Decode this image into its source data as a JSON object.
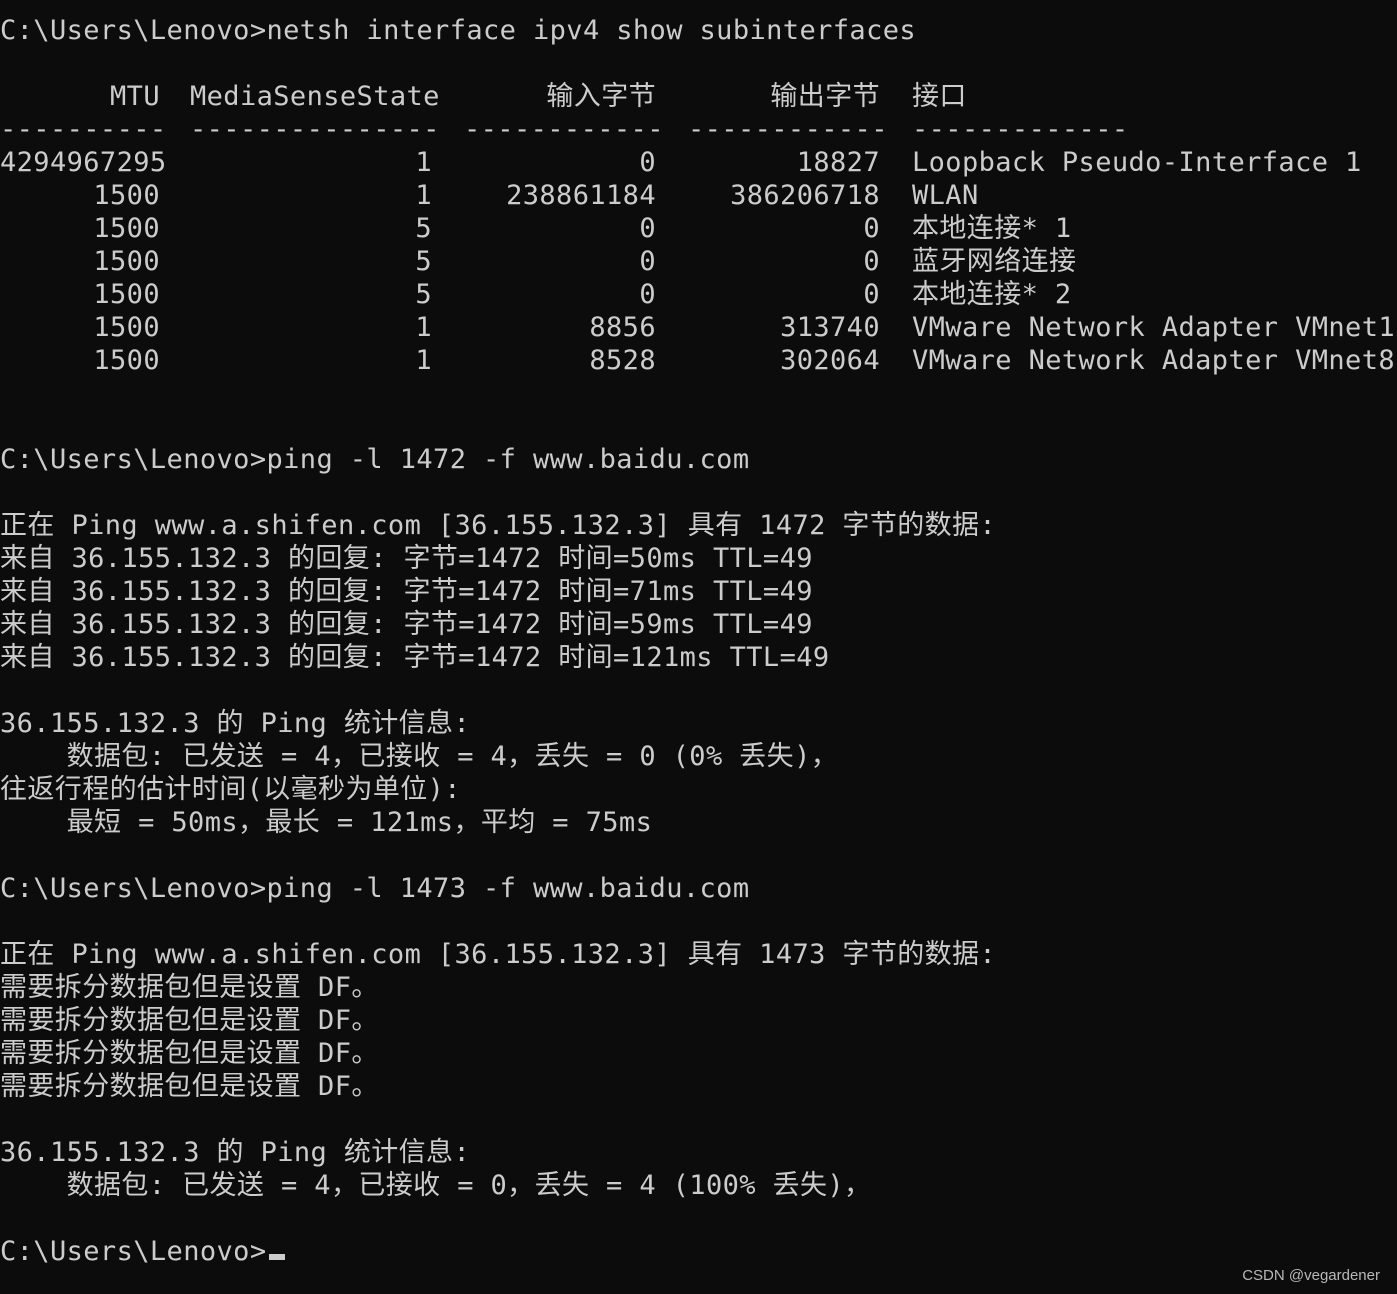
{
  "commands": {
    "c1": "C:\\Users\\Lenovo>netsh interface ipv4 show subinterfaces",
    "c2": "C:\\Users\\Lenovo>ping -l 1472 -f www.baidu.com",
    "c3": "C:\\Users\\Lenovo>ping -l 1473 -f www.baidu.com",
    "prompt": "C:\\Users\\Lenovo>"
  },
  "table": {
    "headers": [
      "MTU",
      "MediaSenseState",
      "输入字节",
      "输出字节",
      "接口"
    ],
    "dashes": [
      "----------",
      "---------------",
      "------------",
      "------------",
      "-------------"
    ],
    "rows": [
      [
        "4294967295",
        "1",
        "0",
        "18827",
        "Loopback Pseudo-Interface 1"
      ],
      [
        "1500",
        "1",
        "238861184",
        "386206718",
        "WLAN"
      ],
      [
        "1500",
        "5",
        "0",
        "0",
        "本地连接* 1"
      ],
      [
        "1500",
        "5",
        "0",
        "0",
        "蓝牙网络连接"
      ],
      [
        "1500",
        "5",
        "0",
        "0",
        "本地连接* 2"
      ],
      [
        "1500",
        "1",
        "8856",
        "313740",
        "VMware Network Adapter VMnet1"
      ],
      [
        "1500",
        "1",
        "8528",
        "302064",
        "VMware Network Adapter VMnet8"
      ]
    ]
  },
  "ping1": {
    "header": "正在 Ping www.a.shifen.com [36.155.132.3] 具有 1472 字节的数据:",
    "replies": [
      "来自 36.155.132.3 的回复: 字节=1472 时间=50ms TTL=49",
      "来自 36.155.132.3 的回复: 字节=1472 时间=71ms TTL=49",
      "来自 36.155.132.3 的回复: 字节=1472 时间=59ms TTL=49",
      "来自 36.155.132.3 的回复: 字节=1472 时间=121ms TTL=49"
    ],
    "stats_title": "36.155.132.3 的 Ping 统计信息:",
    "stats_packets": "    数据包: 已发送 = 4，已接收 = 4，丢失 = 0 (0% 丢失)，",
    "rtt_title": "往返行程的估计时间(以毫秒为单位):",
    "rtt_values": "    最短 = 50ms，最长 = 121ms，平均 = 75ms"
  },
  "ping2": {
    "header": "正在 Ping www.a.shifen.com [36.155.132.3] 具有 1473 字节的数据:",
    "replies": [
      "需要拆分数据包但是设置 DF。",
      "需要拆分数据包但是设置 DF。",
      "需要拆分数据包但是设置 DF。",
      "需要拆分数据包但是设置 DF。"
    ],
    "stats_title": "36.155.132.3 的 Ping 统计信息:",
    "stats_packets": "    数据包: 已发送 = 4，已接收 = 0，丢失 = 4 (100% 丢失)，"
  },
  "watermark": "CSDN @vegardener",
  "colors": {
    "background": "#0c0c0c",
    "text": "#cccccc"
  }
}
